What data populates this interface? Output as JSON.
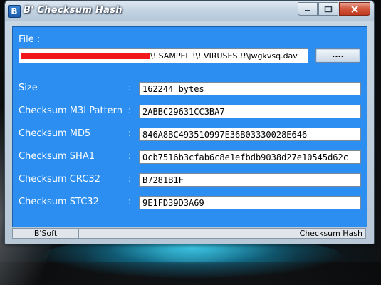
{
  "window": {
    "icon_letter": "B",
    "title": "B' Checksum Hash"
  },
  "file": {
    "label": "File :",
    "path_visible": "\\! SAMPEL !\\! VIRUSES !!\\jwgkvsq.dav",
    "browse_label": "...."
  },
  "fields": [
    {
      "label": "Size",
      "value": "162244 bytes"
    },
    {
      "label": "Checksum M3I Pattern",
      "value": "2ABBC29631CC3BA7"
    },
    {
      "label": "Checksum MD5",
      "value": "846A8BC493510997E36B03330028E646"
    },
    {
      "label": "Checksum SHA1",
      "value": "0cb7516b3cfab6c8e1efbdb9038d27e10545d62c"
    },
    {
      "label": "Checksum CRC32",
      "value": "B7281B1F"
    },
    {
      "label": "Checksum STC32",
      "value": "9E1FD39D3A69"
    }
  ],
  "colon": ":",
  "statusbar": {
    "left": "B'Soft",
    "right": "Checksum Hash"
  },
  "colors": {
    "panel": "#2b8ef0",
    "redaction": "#f0181a"
  }
}
